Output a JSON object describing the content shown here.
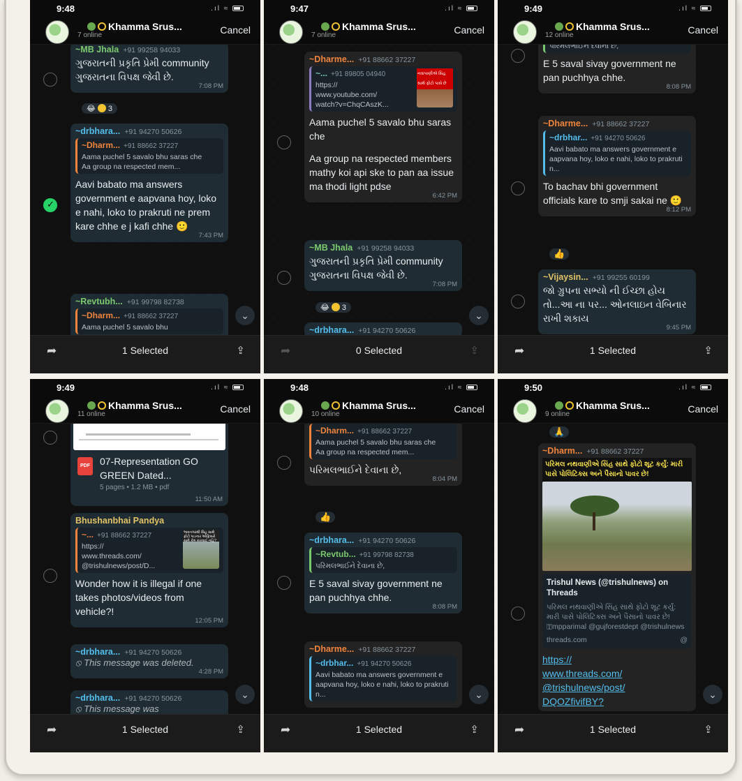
{
  "group": {
    "name": "Khamma Srus...",
    "cancel": "Cancel"
  },
  "icons": {
    "status_signal": "signal-wifi-battery",
    "forward": "forward-arrow-icon",
    "share": "share-icon",
    "scroll_down": "chevron-down-icon",
    "checkbox_checked": "check-icon"
  },
  "phones": [
    {
      "time": "9:48",
      "online": "7 online",
      "footer": "1 Selected",
      "m1": {
        "sender": "~MB Jhala",
        "phone": "+91 99258 94033",
        "text": "ગુજરાતની પ્રકૃતિ પ્રેમી community ગુજરાતના વિપક્ષ જેવી છે.",
        "time": "7:08 PM"
      },
      "react1": "3",
      "m2": {
        "sender": "~drbhara...",
        "phone": "+91 94270 50626",
        "q_sender": "~Dharm...",
        "q_phone": "+91 88662 37227",
        "q_text": "Aama puchel 5 savalo bhu saras che",
        "q_text2": "Aa group na respected  mem...",
        "text": "Aavi babato ma answers government e aapvana hoy, loko e nahi, loko to prakruti ne prem kare chhe e j kafi chhe 🙂",
        "time": "7:43 PM"
      },
      "m3": {
        "sender": "~Revtubh...",
        "phone": "+91 99798 82738",
        "q_sender": "~Dharm...",
        "q_phone": "+91 88662 37227",
        "q_text": "Aama puchel 5 savalo bhu"
      }
    },
    {
      "time": "9:47",
      "online": "7 online",
      "footer": "0 Selected",
      "m1": {
        "sender": "~Dharme...",
        "phone": "+91 88662 37227",
        "q_sender": "~...",
        "q_phone": "+91 89805 04940",
        "q_url1": "https://",
        "q_url2": "www.youtube.com/",
        "q_url3": "watch?v=ChqCAszK...",
        "q_thumb": "નવાપાણીએ સિંહ સાથે ફોટો પાસે છે",
        "text1": "Aama puchel 5 savalo bhu saras che",
        "text2": "Aa group na respected members mathy koi api ske to pan aa issue ma thodi light pdse",
        "time": "6:42 PM"
      },
      "m2": {
        "sender": "~MB Jhala",
        "phone": "+91 99258 94033",
        "text": "ગુજરાતની પ્રકૃતિ પ્રેમી community ગુજરાતના વિપક્ષ જેવી છે.",
        "time": "7:08 PM"
      },
      "react1": "3",
      "m3": {
        "sender": "~drbhara...",
        "phone": "+91 94270 50626"
      }
    },
    {
      "time": "9:49",
      "online": "12 online",
      "footer": "1 Selected",
      "m0": {
        "text": "પરિમલભાઈને દેવાના છે,"
      },
      "m1": {
        "text": "E 5 saval sivay government ne pan puchhya chhe.",
        "time": "8:08 PM"
      },
      "m2": {
        "sender": "~Dharme...",
        "phone": "+91 88662 37227",
        "q_sender": "~drbhar...",
        "q_phone": "+91 94270 50626",
        "q_text": "Aavi babato ma answers government e aapvana hoy, loko e nahi, loko to prakruti n...",
        "text": "To bachav bhi government  officials kare to smji sakai ne 🙂",
        "time": "8:12 PM"
      },
      "react": "👍",
      "m3": {
        "sender": "~Vijaysin...",
        "phone": "+91 99255 60199",
        "text": "જો ગ્રુપના સભ્યો ની ઈચ્છા હોય તો...આ ના પર... ઓનલાઇન વેબિનાર રાખી શકાય",
        "time": "9:45 PM"
      }
    },
    {
      "time": "9:49",
      "online": "11 online",
      "footer": "1 Selected",
      "pdf": {
        "title": "07-Representation GO GREEN Dated...",
        "meta": "5 pages • 1.2 MB • pdf",
        "time": "11:50 AM",
        "icon": "PDF"
      },
      "m1": {
        "sender": "Bhushanbhai Pandya",
        "q_sender": "~...",
        "q_phone": "+91 88662 37227",
        "q_url1": "https://",
        "q_url2": "www.threads.com/",
        "q_url3": "@trishulnews/post/D...",
        "q_thumb": "ભાવનગરથી સિંહ સાથે ફોટો પાડનાર ઓફિસરો સામે કેમ કારવાઈ નહિ?",
        "text": "Wonder how it is illegal if one takes photos/videos from vehicle?!",
        "time": "12:05 PM"
      },
      "m2": {
        "sender": "~drbhara...",
        "phone": "+91 94270 50626",
        "text": "⦸ This message was deleted.",
        "time": "4:28 PM"
      },
      "m3": {
        "sender": "~drbhara...",
        "phone": "+91 94270 50626",
        "text": "⦸ This message was"
      }
    },
    {
      "time": "9:48",
      "online": "10 online",
      "footer": "1 Selected",
      "m1": {
        "q_sender": "~Dharm...",
        "q_phone": "+91 88662 37227",
        "q_text": "Aama puchel 5 savalo bhu saras che",
        "q_text2": "Aa group na respected  mem...",
        "text": "પરિમલભાઈને દેવાના છે,",
        "time": "8:04 PM"
      },
      "react": "👍",
      "m2": {
        "sender": "~drbhara...",
        "phone": "+91 94270 50626",
        "q_sender": "~Revtub...",
        "q_phone": "+91 99798 82738",
        "q_text": "પરિમલભાઈને દેવાના છે,",
        "text": "E 5 saval sivay government ne pan puchhya chhe.",
        "time": "8:08 PM"
      },
      "m3": {
        "sender": "~Dharme...",
        "phone": "+91 88662 37227",
        "q_sender": "~drbhar...",
        "q_phone": "+91 94270 50626",
        "q_text": "Aavi babato ma answers government e aapvana hoy, loko e nahi, loko to prakruti n..."
      }
    },
    {
      "time": "9:50",
      "online": "9 online",
      "footer": "1 Selected",
      "react": "🙏",
      "m1": {
        "sender": "~Dharm...",
        "phone": "+91 88662 37227",
        "banner": "પરિમલ નથવાણીએ સિંહ સાથે ફોટો શૂટ કર્યું: મારી પાસે પોલિટિક્સ અને પૈસાનો પાવર છે!",
        "card_title": "Trishul News (@trishulnews) on Threads",
        "card_desc": "પરિમલ નથવાણીએ સિંહ સાથે ફોટો શૂટ કર્યું: મારી પાસે પોલિટિક્સ અને પૈસાનો પાવર છે! 🅃mpparimal @gujforestdept @trishulnews",
        "card_domain": "threads.com",
        "card_domain_icon": "@",
        "link1": "https://",
        "link2": "www.threads.com/",
        "link3": "@trishulnews/post/",
        "link4": "DQOZfivifBY?"
      }
    }
  ]
}
